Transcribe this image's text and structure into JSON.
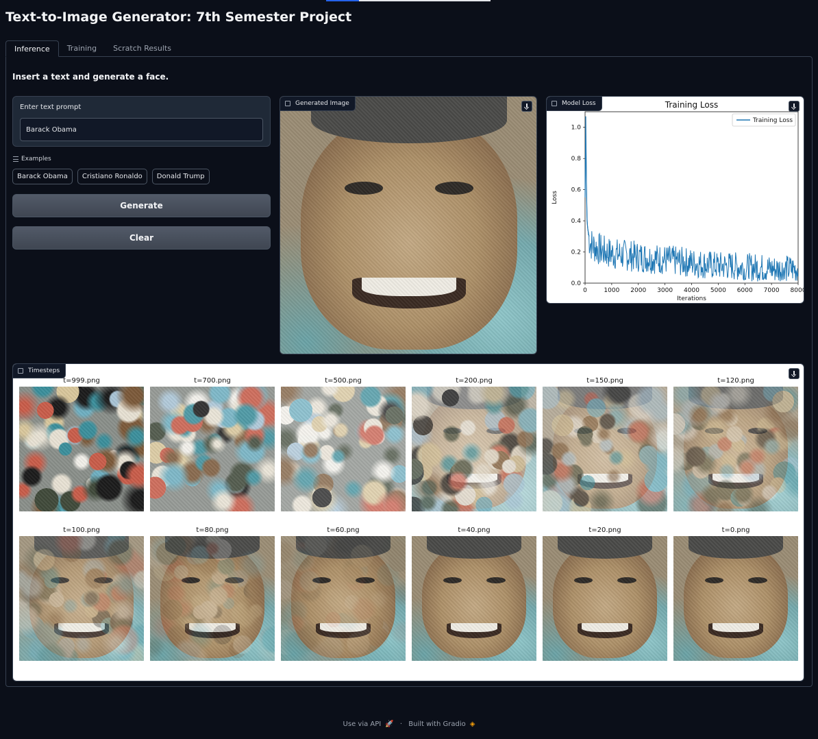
{
  "progress": {
    "value": 0.2
  },
  "app": {
    "title": "Text-to-Image Generator: 7th Semester Project"
  },
  "tabs": [
    {
      "label": "Inference",
      "active": true
    },
    {
      "label": "Training",
      "active": false
    },
    {
      "label": "Scratch Results",
      "active": false
    }
  ],
  "inference": {
    "intro": "Insert a text and generate a face.",
    "prompt_label": "Enter text prompt",
    "prompt_value": "Barack Obama",
    "examples_label": "Examples",
    "examples": [
      "Barack Obama",
      "Cristiano Ronaldo",
      "Donald Trump"
    ],
    "generate_label": "Generate",
    "clear_label": "Clear",
    "generated_image_label": "Generated Image",
    "model_loss_label": "Model Loss",
    "timesteps_label": "Timesteps",
    "timesteps": [
      "t=999.png",
      "t=700.png",
      "t=500.png",
      "t=200.png",
      "t=150.png",
      "t=120.png",
      "t=100.png",
      "t=80.png",
      "t=60.png",
      "t=40.png",
      "t=20.png",
      "t=0.png"
    ]
  },
  "chart_data": {
    "type": "line",
    "title": "Training Loss",
    "xlabel": "Iterations",
    "ylabel": "Loss",
    "xlim": [
      0,
      8000
    ],
    "ylim": [
      0,
      1.1
    ],
    "xticks": [
      0,
      1000,
      2000,
      3000,
      4000,
      5000,
      6000,
      7000,
      8000
    ],
    "yticks": [
      0.0,
      0.2,
      0.4,
      0.6,
      0.8,
      1.0
    ],
    "ytick_labels": [
      "0.0",
      "0.2",
      "0.4",
      "0.6",
      "0.8",
      "1.0"
    ],
    "legend": "top-right",
    "grid": false,
    "series": [
      {
        "name": "Training Loss",
        "color": "#1f77b4",
        "x": [
          0,
          25,
          50,
          75,
          100,
          150,
          200,
          300,
          400,
          500,
          750,
          1000,
          1500,
          2000,
          2500,
          3000,
          3500,
          4000,
          4500,
          5000,
          5500,
          6000,
          6500,
          7000,
          7500,
          8000
        ],
        "y": [
          0.55,
          1.07,
          0.65,
          0.4,
          0.35,
          0.3,
          0.27,
          0.25,
          0.24,
          0.23,
          0.21,
          0.2,
          0.19,
          0.18,
          0.17,
          0.16,
          0.15,
          0.14,
          0.13,
          0.12,
          0.12,
          0.11,
          0.11,
          0.1,
          0.1,
          0.1
        ]
      }
    ],
    "noise_band": {
      "upper": 0.34,
      "lower": 0.0
    }
  },
  "footer": {
    "api": "Use via API",
    "separator": "·",
    "built": "Built with Gradio"
  },
  "icons": {
    "download": "download-icon",
    "image": "image-icon",
    "list": "list-icon",
    "rocket": "rocket-icon",
    "gradio": "gradio-logo-icon"
  }
}
